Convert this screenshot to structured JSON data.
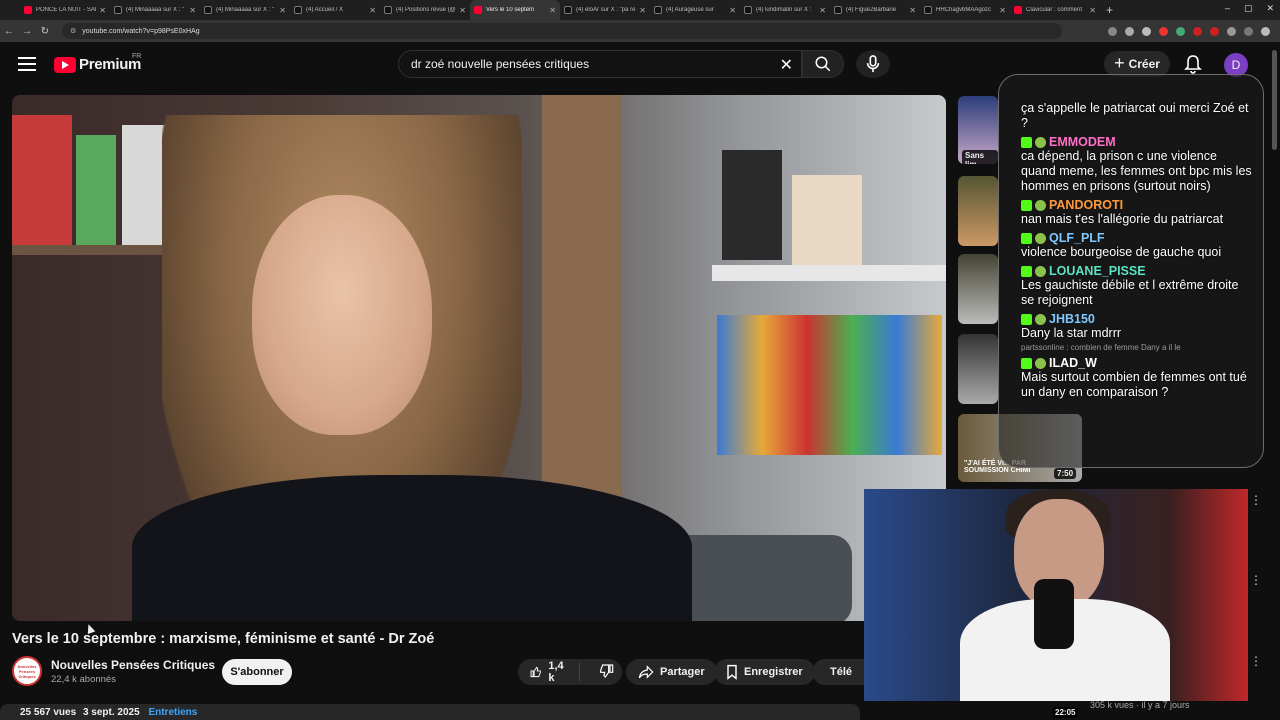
{
  "browser": {
    "tabs": [
      {
        "label": "PONCE LA NUIT - SAI",
        "icon": "yt"
      },
      {
        "label": "(4) Minaaaaa sur X : \"",
        "icon": "x"
      },
      {
        "label": "(4) Minaaaaa sur X : \"",
        "icon": "x"
      },
      {
        "label": "(4) Accueil / X",
        "icon": "x"
      },
      {
        "label": "(4) Positions revue (@",
        "icon": "x"
      },
      {
        "label": "Vers le 10 septem",
        "icon": "yt"
      },
      {
        "label": "(4) eloAr sur X : \"pa re",
        "icon": "x"
      },
      {
        "label": "(4) Aurageuse sur",
        "icon": "x"
      },
      {
        "label": "(4) lundimatin sur X :",
        "icon": "x"
      },
      {
        "label": "(4) Figue2Barbarie",
        "icon": "x"
      },
      {
        "label": "HHChagvbMAAgozc",
        "icon": "x"
      },
      {
        "label": "Clavicular : comment",
        "icon": "yt"
      }
    ],
    "active_tab": 5,
    "url": "youtube.com/watch?v=p98PsE0xHAg"
  },
  "header": {
    "brand": "Premium",
    "country": "FR",
    "search_value": "dr zoé nouvelle pensées critiques",
    "create_label": "Créer",
    "avatar_letter": "D"
  },
  "video": {
    "title": "Vers le 10 septembre : marxisme, féminisme et santé - Dr Zoé",
    "channel": "Nouvelles Pensées Critiques",
    "channel_logo_text": "Nouvelles Pensées Critiques",
    "subscribers": "22,4 k abonnés",
    "subscribe_label": "S'abonner",
    "likes": "1,4 k",
    "share_label": "Partager",
    "save_label": "Enregistrer",
    "download_label": "Télé",
    "views": "25 567 vues",
    "date": "3 sept. 2025",
    "tag": "Entretiens"
  },
  "chat": {
    "messages": [
      {
        "user": "",
        "text": "ça s'appelle le patriarcat oui merci Zoé et ?",
        "color": "#ffffff"
      },
      {
        "user": "EMMODEM",
        "text": "ca dépend, la prison c une violence quand meme, les femmes ont bpc mis les hommes en prisons (surtout noirs)",
        "color": "#ff6ec7"
      },
      {
        "user": "PANDOROTI",
        "text": "nan mais t'es l'allégorie du patriarcat",
        "color": "#ff9a3c"
      },
      {
        "user": "QLF_PLF",
        "text": "violence bourgeoise de gauche quoi",
        "color": "#7ec8ff"
      },
      {
        "user": "LOUANE_PISSE",
        "text": "Les gauchiste débile et l extrême droite se rejoignent",
        "color": "#5ce1c4"
      },
      {
        "user": "JHB150",
        "text": "Dany la star mdrrr",
        "color": "#7ec8ff"
      },
      {
        "user": "ILAD_W",
        "text": "Mais surtout combien de femmes ont tué un dany en comparaison ?",
        "color": "#ffffff"
      }
    ],
    "system_line": "partssonline : combien de femme Dany a il le"
  },
  "sidebar": {
    "thumb1_label": "Sans lim",
    "thumb_last_caption": "\"J'AI ÉTÉ VI... PAR SOUMISSION CHIMI",
    "thumb_last_duration": "7:50",
    "bottom_duration": "22:05",
    "bottom_meta": "305 k vues · il y a 7 jours"
  },
  "colors": {
    "accent_red": "#ff0033",
    "link_blue": "#3ea6ff",
    "kick_green": "#53fc18"
  }
}
